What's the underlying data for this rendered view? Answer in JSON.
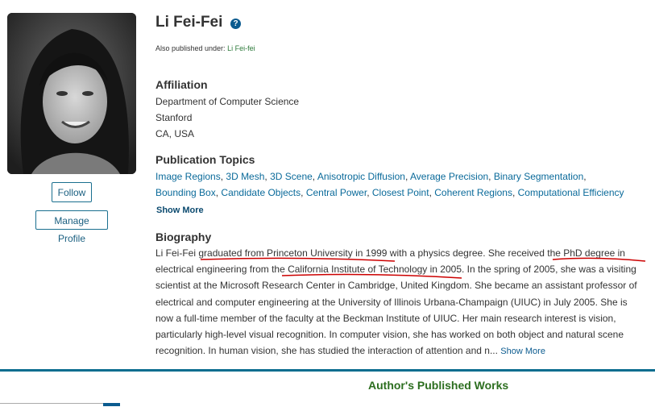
{
  "profile": {
    "name": "Li Fei-Fei",
    "alias_prefix": "Also published under:",
    "alias_name": "Li Fei-fei",
    "follow_label": "Follow",
    "manage_label": "Manage Profile"
  },
  "affiliation": {
    "heading": "Affiliation",
    "lines": [
      "Department of Computer Science",
      "Stanford",
      "CA, USA"
    ]
  },
  "topics": {
    "heading": "Publication Topics",
    "row1": [
      "Image Regions",
      "3D Mesh",
      "3D Scene",
      "Anisotropic Diffusion",
      "Average Precision",
      "Binary Segmentation"
    ],
    "row2": [
      "Bounding Box",
      "Candidate Objects",
      "Central Power",
      "Closest Point",
      "Coherent Regions",
      "Computational Efficiency"
    ],
    "show_more": "Show More"
  },
  "biography": {
    "heading": "Biography",
    "lines": [
      "Li Fei-Fei graduated from Princeton University in 1999 with a physics degree. She received the PhD degree in",
      "electrical engineering from the California Institute of Technology in 2005. In the spring of 2005, she was a visiting",
      "scientist at the Microsoft Research Center in Cambridge, United Kingdom. She became an assistant professor of",
      "electrical and computer engineering at the University of Illinois Urbana-Champaign (UIUC) in July 2005. She is",
      "now a full-time member of the faculty at the Beckman Institute of UIUC. Her main research interest is vision,",
      "particularly high-level visual recognition. In computer vision, she has worked on both object and natural scene",
      "recognition. In human vision, she has studied the interaction of attention and n..."
    ],
    "show_more": "Show More"
  },
  "works": {
    "heading": "Author's Published Works"
  },
  "icons": {
    "help": "help-icon",
    "photo": "profile-photo"
  },
  "colors": {
    "link": "#0a6a9a",
    "accent": "#0b6d8f",
    "works_heading": "#2c6e1f",
    "annotation": "#cc0000"
  }
}
